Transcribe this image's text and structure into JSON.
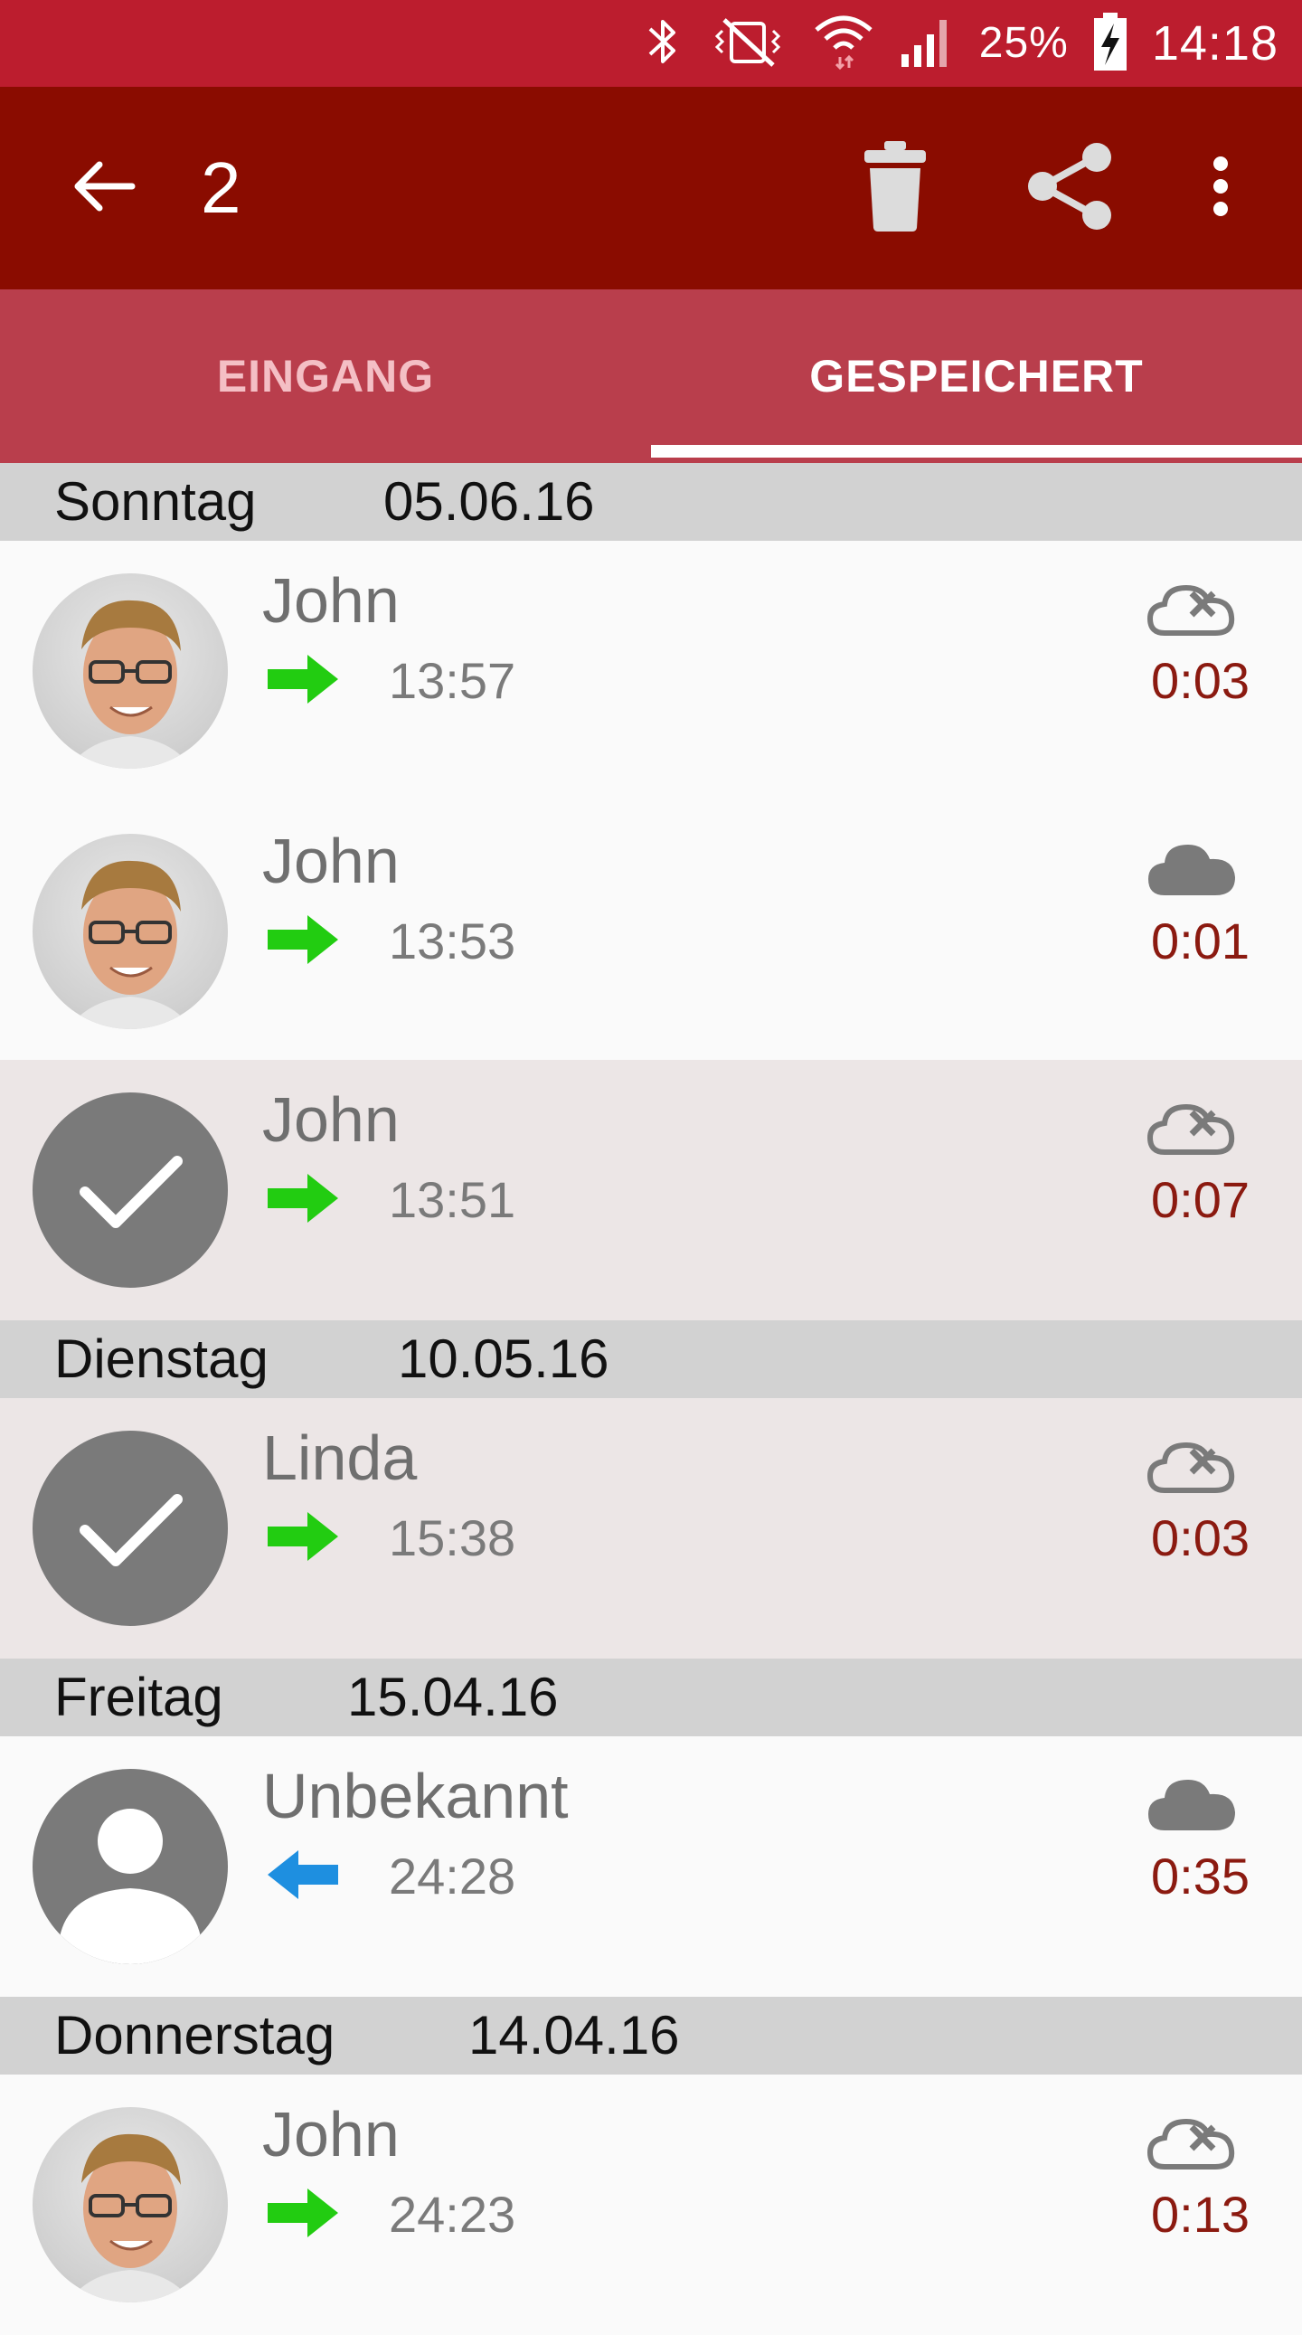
{
  "status_bar": {
    "battery_percent": "25%",
    "clock": "14:18",
    "icons": [
      "bluetooth-icon",
      "vibrate-mute-icon",
      "wifi-icon",
      "signal-icon",
      "battery-charging-icon"
    ]
  },
  "toolbar": {
    "selected_count": "2",
    "icons": [
      "back-arrow-icon",
      "trash-icon",
      "share-icon",
      "more-vert-icon"
    ]
  },
  "tabs": [
    {
      "label": "EINGANG",
      "active": false
    },
    {
      "label": "GESPEICHERT",
      "active": true
    }
  ],
  "sections": [
    {
      "day": "Sonntag",
      "date": "05.06.16",
      "calls": [
        {
          "name": "John",
          "time": "13:57",
          "duration": "0:03",
          "direction": "outgoing",
          "cloud": "cloud-not-uploaded-icon",
          "avatar": "photo",
          "selected": false
        },
        {
          "name": "John",
          "time": "13:53",
          "duration": "0:01",
          "direction": "outgoing",
          "cloud": "cloud-uploaded-icon",
          "avatar": "photo",
          "selected": false
        },
        {
          "name": "John",
          "time": "13:51",
          "duration": "0:07",
          "direction": "outgoing",
          "cloud": "cloud-not-uploaded-icon",
          "avatar": "check",
          "selected": true
        }
      ]
    },
    {
      "day": "Dienstag",
      "date": "10.05.16",
      "calls": [
        {
          "name": "Linda",
          "time": "15:38",
          "duration": "0:03",
          "direction": "outgoing",
          "cloud": "cloud-not-uploaded-icon",
          "avatar": "check",
          "selected": true
        }
      ]
    },
    {
      "day": "Freitag",
      "date": "15.04.16",
      "calls": [
        {
          "name": "Unbekannt",
          "time": "24:28",
          "duration": "0:35",
          "direction": "incoming",
          "cloud": "cloud-uploaded-icon",
          "avatar": "unknown",
          "selected": false
        }
      ]
    },
    {
      "day": "Donnerstag",
      "date": "14.04.16",
      "calls": [
        {
          "name": "John",
          "time": "24:23",
          "duration": "0:13",
          "direction": "outgoing",
          "cloud": "cloud-not-uploaded-icon",
          "avatar": "photo",
          "selected": false
        }
      ]
    }
  ],
  "colors": {
    "status_bar": "#bc1d2e",
    "toolbar": "#8a0c00",
    "tabs": "#b93e4c",
    "outgoing_arrow": "#22cc11",
    "incoming_arrow": "#1e8fe0",
    "duration_text": "#8b1a10"
  }
}
